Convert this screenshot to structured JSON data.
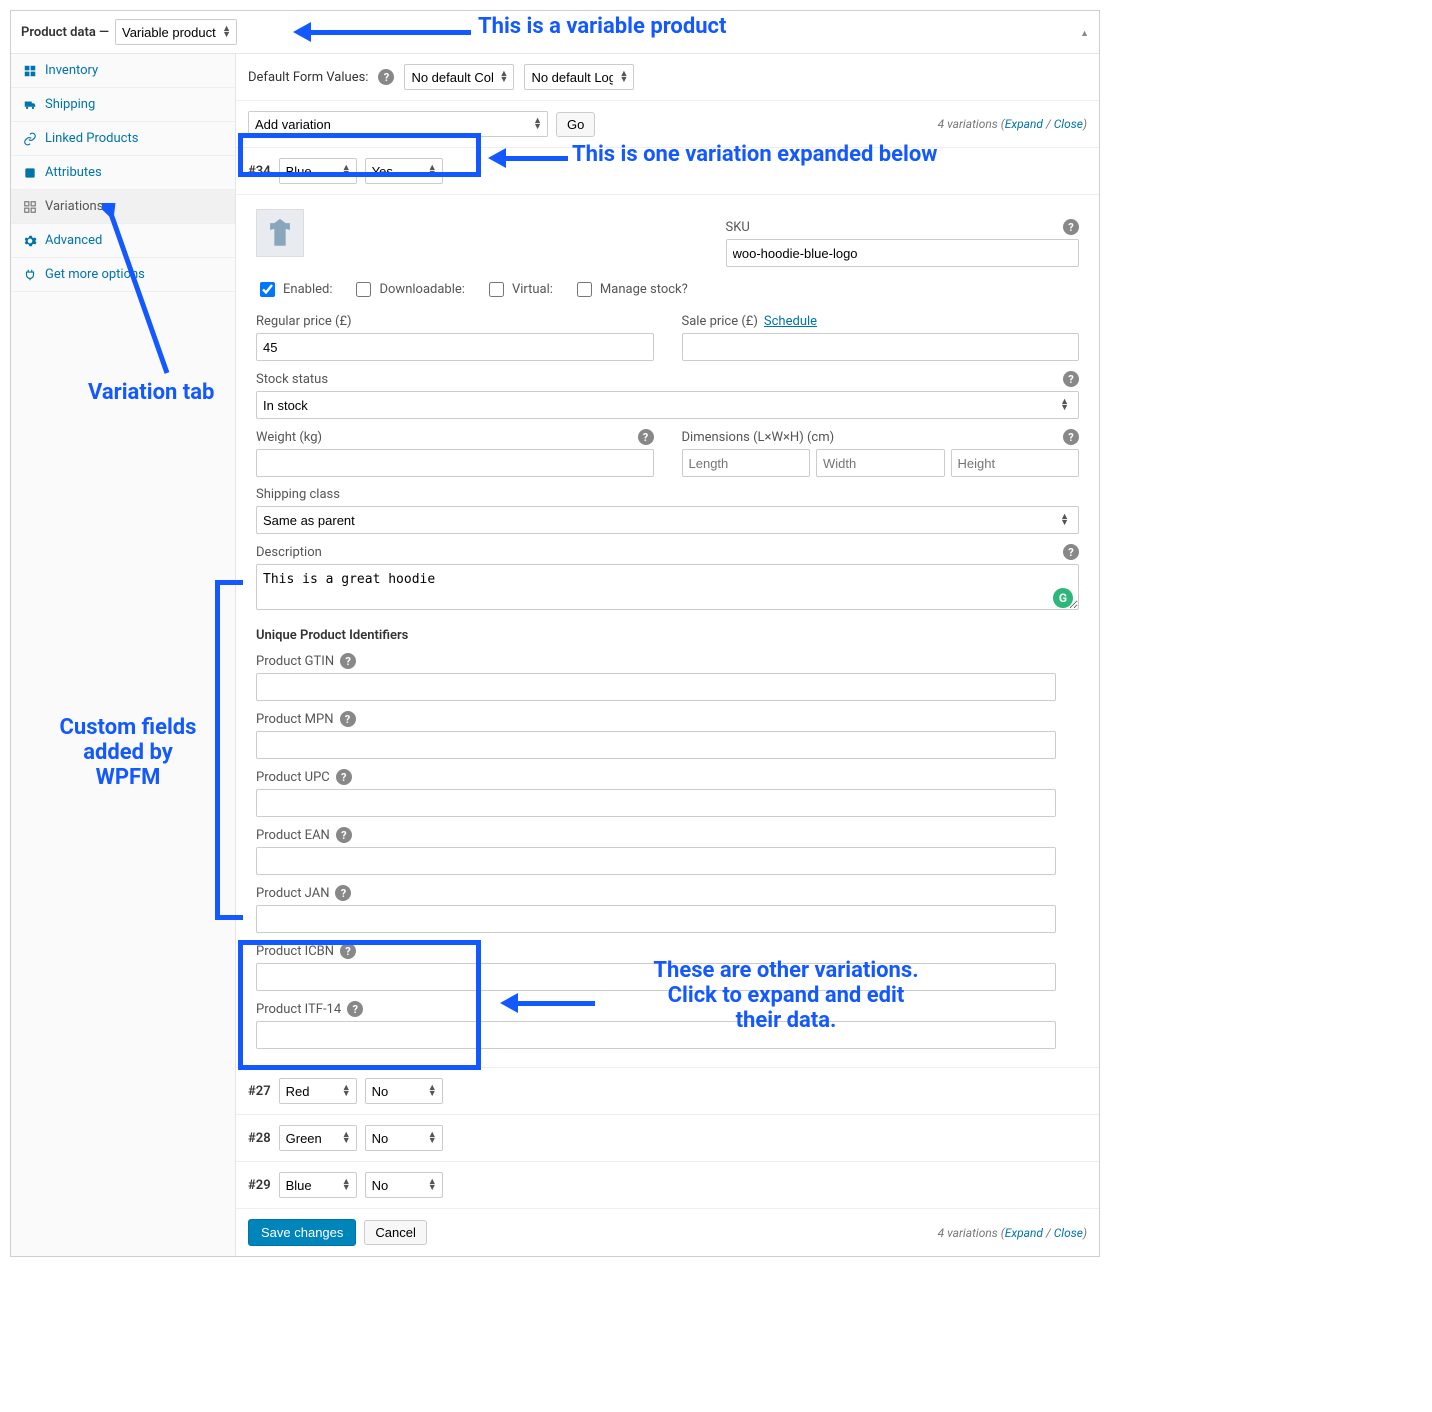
{
  "header": {
    "title": "Product data —",
    "product_type": "Variable product"
  },
  "tabs": [
    {
      "label": "Inventory"
    },
    {
      "label": "Shipping"
    },
    {
      "label": "Linked Products"
    },
    {
      "label": "Attributes"
    },
    {
      "label": "Variations"
    },
    {
      "label": "Advanced"
    },
    {
      "label": "Get more options"
    }
  ],
  "default_form": {
    "label": "Default Form Values:",
    "color": "No default Color…",
    "logo": "No default Logo…"
  },
  "add_variation": {
    "select": "Add variation",
    "go": "Go",
    "info_count": "4 variations",
    "expand": "Expand",
    "close": "Close"
  },
  "variation": {
    "id": "#34",
    "color": "Blue",
    "logo": "Yes",
    "sku_label": "SKU",
    "sku": "woo-hoodie-blue-logo",
    "checks": {
      "enabled": "Enabled:",
      "downloadable": "Downloadable:",
      "virtual": "Virtual:",
      "manage_stock": "Manage stock?"
    },
    "regular_price_label": "Regular price (£)",
    "regular_price": "45",
    "sale_price_label": "Sale price (£)",
    "schedule": "Schedule",
    "stock_status_label": "Stock status",
    "stock_status": "In stock",
    "weight_label": "Weight (kg)",
    "dimensions_label": "Dimensions (L×W×H) (cm)",
    "dims": {
      "length": "Length",
      "width": "Width",
      "height": "Height"
    },
    "shipping_class_label": "Shipping class",
    "shipping_class": "Same as parent",
    "description_label": "Description",
    "description": "This is a great hoodie",
    "upi_title": "Unique Product Identifiers",
    "upi": [
      "Product GTIN",
      "Product MPN",
      "Product UPC",
      "Product EAN",
      "Product JAN",
      "Product ICBN",
      "Product ITF-14"
    ]
  },
  "other_variations": [
    {
      "id": "#27",
      "color": "Red",
      "logo": "No"
    },
    {
      "id": "#28",
      "color": "Green",
      "logo": "No"
    },
    {
      "id": "#29",
      "color": "Blue",
      "logo": "No"
    }
  ],
  "save": {
    "save": "Save changes",
    "cancel": "Cancel"
  },
  "annotations": {
    "top": "This is a variable product",
    "tab": "Variation tab",
    "expanded": "This is one variation expanded below",
    "custom": "Custom fields\nadded by\nWPFM",
    "others": "These are other variations.\nClick to expand and edit\ntheir data."
  }
}
